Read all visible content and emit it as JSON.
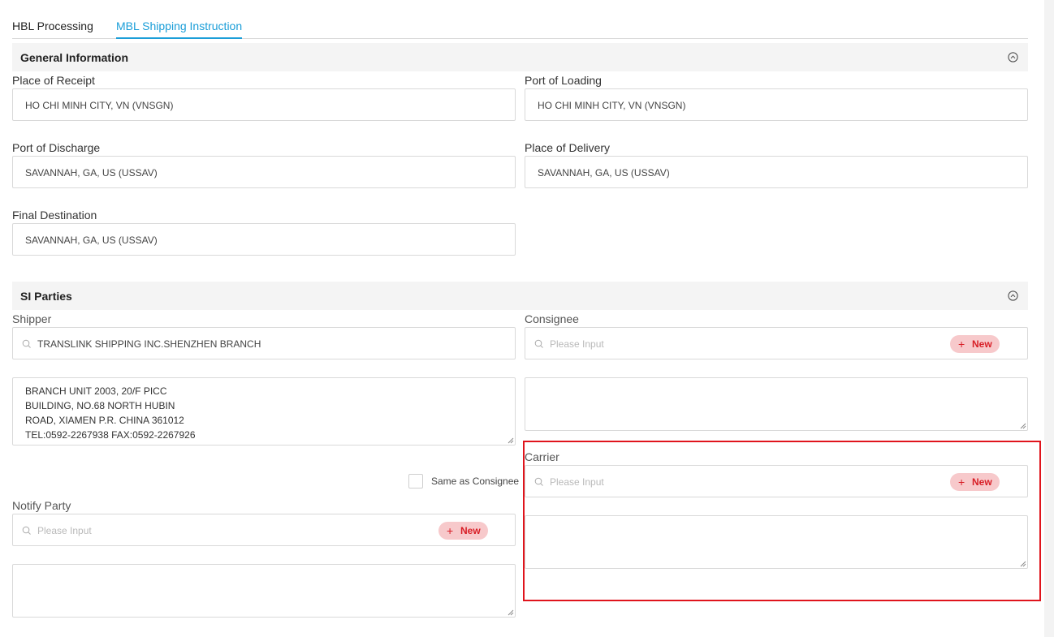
{
  "tabs": [
    {
      "label": "HBL Processing",
      "active": false
    },
    {
      "label": "MBL Shipping Instruction",
      "active": true
    }
  ],
  "general_info": {
    "title": "General Information",
    "place_of_receipt": {
      "label": "Place of Receipt",
      "value": "HO CHI MINH CITY, VN (VNSGN)"
    },
    "port_of_loading": {
      "label": "Port of Loading",
      "value": "HO CHI MINH CITY, VN (VNSGN)"
    },
    "port_of_discharge": {
      "label": "Port of Discharge",
      "value": "SAVANNAH, GA, US (USSAV)"
    },
    "place_of_delivery": {
      "label": "Place of Delivery",
      "value": "SAVANNAH, GA, US (USSAV)"
    },
    "final_destination": {
      "label": "Final Destination",
      "value": "SAVANNAH, GA, US (USSAV)"
    }
  },
  "si_parties": {
    "title": "SI Parties",
    "shipper": {
      "label": "Shipper",
      "value": "TRANSLINK SHIPPING INC.SHENZHEN BRANCH",
      "address_lines": [
        "BRANCH UNIT 2003, 20/F PICC",
        "BUILDING, NO.68 NORTH HUBIN",
        "ROAD, XIAMEN P.R. CHINA 361012",
        "TEL:0592-2267938 FAX:0592-2267926"
      ]
    },
    "consignee": {
      "label": "Consignee",
      "placeholder": "Please Input",
      "new_label": "New"
    },
    "same_as_consignee": {
      "label": "Same as Consignee",
      "checked": false
    },
    "carrier": {
      "label": "Carrier",
      "placeholder": "Please Input",
      "new_label": "New"
    },
    "notify_party": {
      "label": "Notify Party",
      "placeholder": "Please Input",
      "new_label": "New"
    }
  },
  "colors": {
    "accent": "#1b9ed8",
    "new_button_bg": "#f7c9cb",
    "new_button_text": "#d81e26",
    "highlight": "#e0141c"
  }
}
